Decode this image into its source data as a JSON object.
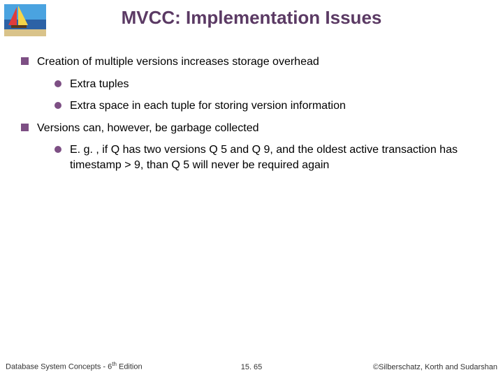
{
  "title": "MVCC: Implementation Issues",
  "bullets": {
    "b1": "Creation of multiple versions increases storage overhead",
    "b1a": "Extra tuples",
    "b1b": "Extra space in each tuple for storing version information",
    "b2": "Versions can, however, be garbage collected",
    "b2a": "E. g. , if Q has two versions Q 5 and Q 9, and the oldest active transaction has timestamp > 9, than Q 5 will never be required again"
  },
  "footer": {
    "left_prefix": "Database System Concepts - 6",
    "left_sup": "th",
    "left_suffix": " Edition",
    "center": "15. 65",
    "right": "©Silberschatz, Korth and Sudarshan"
  }
}
